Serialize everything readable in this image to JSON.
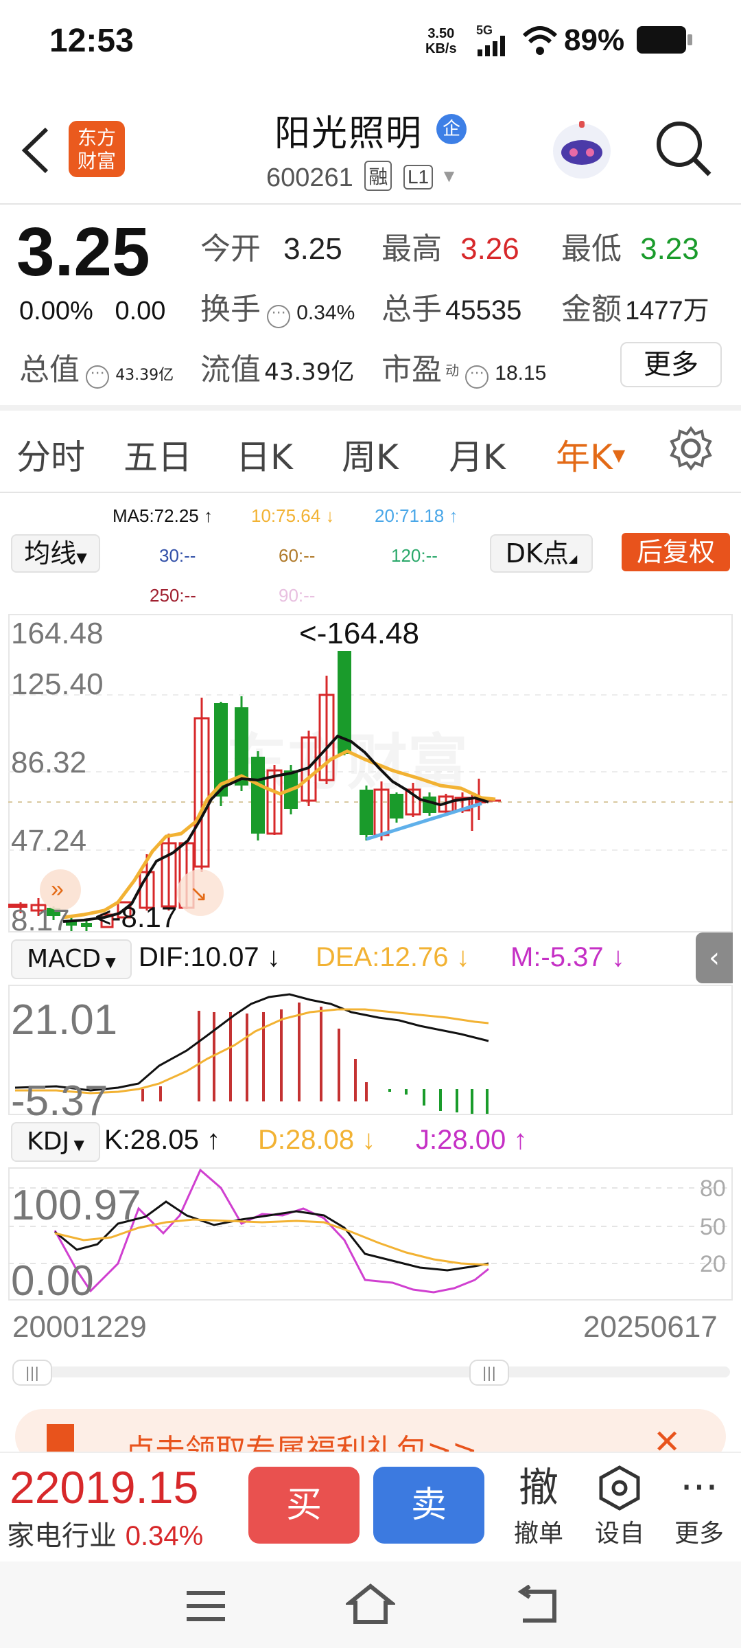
{
  "status_bar": {
    "time": "12:53",
    "net_speed_value": "3.50",
    "net_speed_unit": "KB/s",
    "network": "5G",
    "battery": "89%"
  },
  "header": {
    "app_logo_line1": "东方",
    "app_logo_line2": "财富",
    "stock_name": "阳光照明",
    "enterprise_badge": "企",
    "stock_code": "600261",
    "tag_margin": "融",
    "tag_level": "L1"
  },
  "quote": {
    "price": "3.25",
    "change_pct": "0.00%",
    "change_amt": "0.00",
    "open_label": "今开",
    "open": "3.25",
    "high_label": "最高",
    "high": "3.26",
    "low_label": "最低",
    "low": "3.23",
    "turnover_label": "换手",
    "turnover": "0.34%",
    "volume_label": "总手",
    "volume": "45535",
    "amount_label": "金额",
    "amount": "1477万",
    "mktcap_label": "总值",
    "mktcap": "43.39亿",
    "float_label": "流值",
    "float_cap": "43.39亿",
    "pe_label": "市盈",
    "pe_sup": "动",
    "pe": "18.15",
    "more_label": "更多"
  },
  "tabs": [
    "分时",
    "五日",
    "日K",
    "周K",
    "月K",
    "年K"
  ],
  "ma": {
    "ma5": "MA5:72.25",
    "ma10": "10:75.64",
    "ma20": "20:71.18",
    "ma30": "30:--",
    "ma60": "60:--",
    "ma120": "120:--",
    "ma250": "250:--",
    "ma90": "90:--",
    "mean_btn": "均线",
    "dk_btn": "DK点",
    "fq_btn": "后复权"
  },
  "kline": {
    "axis_top": "164.48",
    "axis_2": "125.40",
    "axis_3": "86.32",
    "axis_4": "47.24",
    "axis_bottom": "8.17",
    "max_label": "<-164.48",
    "min_label": "<-8.17",
    "watermark": "东方财富"
  },
  "macd": {
    "name": "MACD",
    "dif": "DIF:10.07",
    "dea": "DEA:12.76",
    "m": "M:-5.37",
    "axis_top": "21.01",
    "axis_bottom": "-5.37"
  },
  "kdj": {
    "name": "KDJ",
    "k": "K:28.05",
    "d": "D:28.08",
    "j": "J:28.00",
    "axis_top": "100.97",
    "axis_bottom": "0.00",
    "ref_80": "80",
    "ref_50": "50",
    "ref_20": "20"
  },
  "dates": {
    "start": "20001229",
    "end": "20250617"
  },
  "banner": {
    "text": "点击领取专属福利礼包>>"
  },
  "bottom": {
    "index_value": "22019.15",
    "index_name": "家电行业",
    "index_pct": "0.34%",
    "buy": "买",
    "sell": "卖",
    "cancel_big": "撤",
    "cancel_label": "撤单",
    "custom_label": "设自",
    "more_label": "更多"
  },
  "colors": {
    "up": "#d7282a",
    "down": "#1a9b2b",
    "accent": "#e36a16",
    "ma5": "#111111",
    "ma10": "#f2b233",
    "ma20": "#4aa7e8",
    "kdj_j": "#d040d0"
  }
}
